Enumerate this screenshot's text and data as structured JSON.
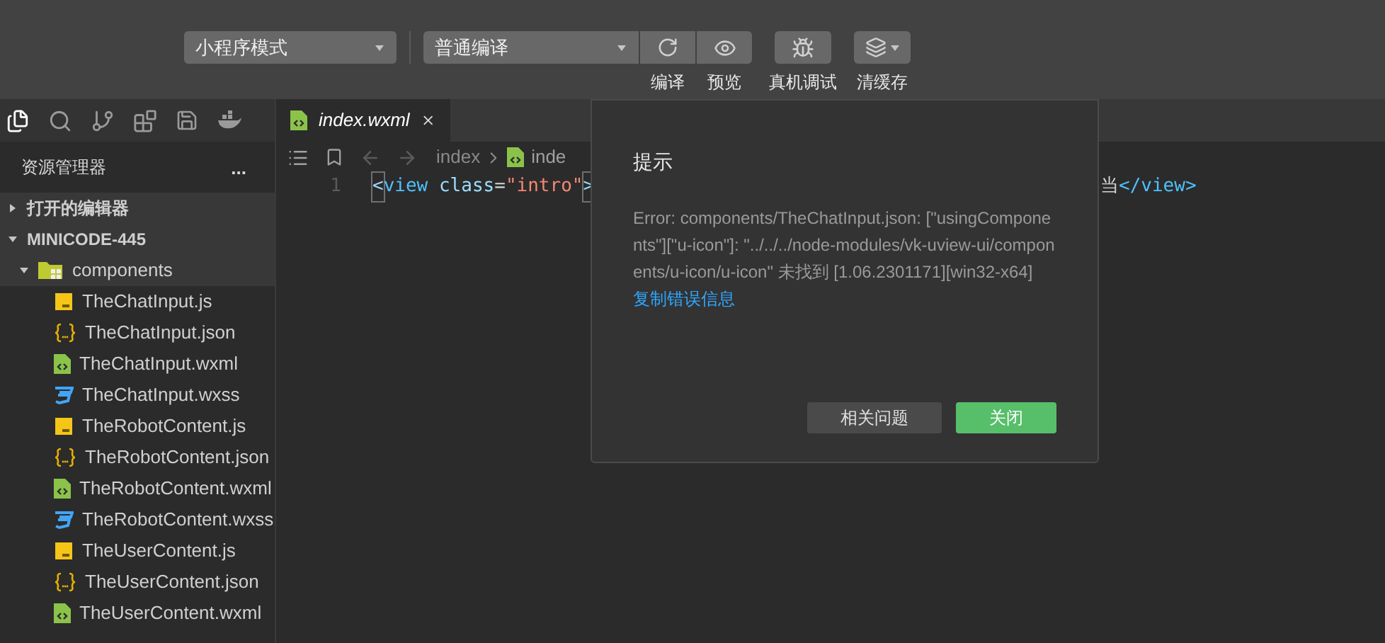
{
  "toolbar": {
    "mode_select": {
      "value": "小程序模式"
    },
    "compile_select": {
      "value": "普通编译"
    },
    "actions": [
      {
        "kind": "compile",
        "label": "编译"
      },
      {
        "kind": "preview",
        "label": "预览"
      },
      {
        "kind": "debug",
        "label": "真机调试"
      },
      {
        "kind": "cache",
        "label": "清缓存"
      }
    ]
  },
  "sidebar": {
    "title": "资源管理器",
    "more": "...",
    "sections": [
      {
        "label": "打开的编辑器",
        "expanded": false
      },
      {
        "label": "MINICODE-445",
        "expanded": true,
        "children": [
          {
            "label": "components",
            "kind": "folder",
            "expanded": true,
            "children": [
              {
                "label": "TheChatInput.js",
                "kind": "js"
              },
              {
                "label": "TheChatInput.json",
                "kind": "json"
              },
              {
                "label": "TheChatInput.wxml",
                "kind": "wxml"
              },
              {
                "label": "TheChatInput.wxss",
                "kind": "wxss"
              },
              {
                "label": "TheRobotContent.js",
                "kind": "js"
              },
              {
                "label": "TheRobotContent.json",
                "kind": "json"
              },
              {
                "label": "TheRobotContent.wxml",
                "kind": "wxml"
              },
              {
                "label": "TheRobotContent.wxss",
                "kind": "wxss"
              },
              {
                "label": "TheUserContent.js",
                "kind": "js"
              },
              {
                "label": "TheUserContent.json",
                "kind": "json"
              },
              {
                "label": "TheUserContent.wxml",
                "kind": "wxml"
              }
            ]
          }
        ]
      }
    ]
  },
  "editor": {
    "tabs": [
      {
        "label": "index.wxml",
        "selected": true
      }
    ],
    "breadcrumb": [
      "index",
      "inde"
    ],
    "lines": [
      {
        "number": "1",
        "before": [
          {
            "text": "<",
            "kind": "bracket"
          },
          {
            "text": "view",
            "kind": "tag"
          },
          {
            "text": " class",
            "kind": "attr"
          },
          {
            "text": "=",
            "kind": "plain"
          },
          {
            "text": "\"intro\"",
            "kind": "string"
          },
          {
            "text": ">",
            "kind": "bracket"
          }
        ],
        "after": [
          {
            "text": "当",
            "kind": "plain"
          },
          {
            "text": "</view>",
            "kind": "tag"
          }
        ]
      }
    ]
  },
  "dialog": {
    "title": "提示",
    "message": "Error: components/TheChatInput.json: [\"usingComponents\"][\"u-icon\"]: \"../../../node-modules/vk-uview-ui/components/u-icon/u-icon\" 未找到 [1.06.2301171][win32-x64]",
    "link": "复制错误信息",
    "buttons": [
      {
        "label": "相关问题",
        "kind": "secondary"
      },
      {
        "label": "关闭",
        "kind": "primary"
      }
    ]
  }
}
